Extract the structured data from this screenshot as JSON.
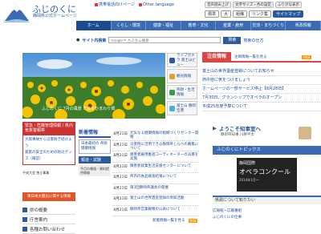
{
  "header": {
    "site_title": "ふじのくに",
    "site_subtitle": "静岡県公式ホームページ",
    "top_links": [
      "携帯電話向けページ",
      "Other language",
      "音声読み上げ",
      "文字サイズ・色の設定",
      "ふりがな表示"
    ],
    "font_controls": [
      "文字",
      "標準",
      "大",
      "色"
    ],
    "util_links": [
      "組織",
      "リンク集",
      "サイトマップ"
    ]
  },
  "nav": {
    "items": [
      "ホーム",
      "くらし・環境",
      "健康・福祉",
      "教育・文化",
      "産業・雇用",
      "交流・まちづくり",
      "県政情報"
    ]
  },
  "search": {
    "label": "サイト内検索",
    "placeholder": "Google™ カスタム検索",
    "button": "検索",
    "extra": "検索の仕方"
  },
  "hero": {
    "caption": "ふじのくに 7月の風景 たまのひまわり畑"
  },
  "side_buttons": [
    "ライブカメラ 富士山ビュー",
    "観光情報",
    "県政・生活 情報",
    "富士山 静岡空港"
  ],
  "attention": {
    "title": "注目情報",
    "more": "注目情報一覧を見る",
    "rss": "RSS",
    "items": [
      "富士山の世界遺産登録についてお知らせ",
      "熱中症に気をつけましょう",
      "ホームページの一部サービス停止【8月28日】",
      "7月30日、グランシップでオペラのオープン",
      "平成25年度予算について"
    ]
  },
  "emergency": {
    "title": "緊急・危機管理情報 / 県内気象警報等",
    "items": [
      "大雨事故から災害防ぎ続けよう",
      "家庭の安全のための防災グッズ（確認）"
    ]
  },
  "small_badge": "平成大会 独立事業",
  "orange_button": "東日本大震災に関する情報",
  "left_nav": [
    "県の概要",
    "庁舎案内",
    "各種お問い合わせ"
  ],
  "news": {
    "title": "新着情報",
    "side": {
      "box1": "日本最初の 県民健康情報",
      "label": "報道・試験",
      "gray": "今月の報道・資料提供情報"
    },
    "rows": [
      {
        "date": "8月21日",
        "text": "元気なる健康情報の組織づくりセンター開催"
      },
      {
        "date": "8月21日",
        "text": "災害時に活用できる静岡県しらべの募集について"
      },
      {
        "date": "8月21日",
        "text": "障害者雇用推進コーディネーターの派遣を実施"
      },
      {
        "date": "8月21日",
        "text": "障害者就業生活支援センターについて"
      },
      {
        "date": "8月21日",
        "text": "県内の食品検査結果について"
      },
      {
        "date": "8月21日",
        "text": "第3回静岡県議会の開催"
      },
      {
        "date": "8月21日",
        "text": "富士山の世界遺産登録の周知活動"
      },
      {
        "date": "8月21日",
        "text": "静岡県営業戦略の公表について"
      }
    ],
    "more": "新着情報一覧を見る",
    "rss": "RSS"
  },
  "welcome": {
    "title": "ようこそ知事室へ",
    "sub": "静岡県知事 川勝平太"
  },
  "topics": {
    "title": "ふじのくにトピックス"
  },
  "opera": {
    "line1": "静岡国際",
    "line2": "オペラコンクール",
    "dates": "2014年1月～"
  },
  "region": {
    "title": "県政について知りたい",
    "items": [
      "広報紙・広聴番組",
      "ふじのくにの仕事"
    ]
  }
}
